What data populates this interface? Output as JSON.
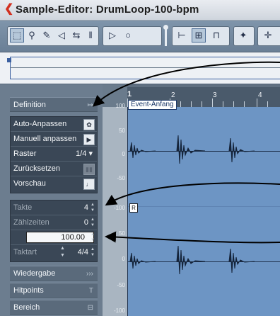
{
  "window": {
    "title": "Sample-Editor: DrumLoop-100-bpm",
    "colors": {
      "accent": "#d23020",
      "wave_bg": "#6d95c4",
      "panel_bg": "#6c7d8f"
    }
  },
  "toolbar": {
    "buttons": [
      {
        "name": "range-select-icon",
        "glyph": "⬚",
        "selected": true
      },
      {
        "name": "zoom-icon",
        "glyph": "⚲"
      },
      {
        "name": "draw-icon",
        "glyph": "✎"
      },
      {
        "name": "play-icon",
        "glyph": "🔈"
      },
      {
        "name": "scrub-icon",
        "glyph": "⇆"
      },
      {
        "name": "hitpoint-icon",
        "glyph": "‖"
      },
      {
        "name": "play-arrow-icon",
        "glyph": "▷"
      },
      {
        "name": "loop-icon",
        "glyph": "○"
      },
      {
        "name": "snap-to-zero-icon",
        "glyph": "⊢"
      },
      {
        "name": "autoscroll-icon",
        "glyph": "⊞"
      },
      {
        "name": "show-regions-icon",
        "glyph": "⊓"
      },
      {
        "name": "audio-event-icon",
        "glyph": "✦"
      },
      {
        "name": "marker-icon",
        "glyph": "✛"
      }
    ]
  },
  "panel": {
    "sections": [
      {
        "key": "definition",
        "label": "Definition",
        "icon": "↦"
      },
      {
        "key": "wiedergabe",
        "label": "Wiedergabe",
        "icon": "›››"
      },
      {
        "key": "hitpoints",
        "label": "Hitpoints",
        "icon": "T"
      },
      {
        "key": "bereich",
        "label": "Bereich",
        "icon": "⊟"
      }
    ],
    "actions": [
      {
        "label": "Auto-Anpassen",
        "icon": "gear-icon",
        "glyph": "✿"
      },
      {
        "label": "Manuell anpassen",
        "icon": "play-icon",
        "glyph": "▶"
      },
      {
        "label": "Raster",
        "value": "1/4"
      },
      {
        "label": "Zurücksetzen",
        "icon": "reset-icon",
        "glyph": "▮▮"
      },
      {
        "label": "Vorschau",
        "icon": "note-icon",
        "glyph": "♩"
      }
    ],
    "musical": {
      "takte_label": "Takte",
      "takte_value": "4",
      "zaehlzeiten_label": "Zählzeiten",
      "zaehlzeiten_value": "0",
      "tempo_value": "100.00",
      "taktart_label": "Taktart",
      "taktart_value": "4/4"
    }
  },
  "ruler": {
    "bars": [
      "1",
      "2",
      "3",
      "4"
    ]
  },
  "amplitude_scale": {
    "labels": [
      "100",
      "50",
      "0",
      "-50",
      "-100",
      "50",
      "0",
      "-50",
      "-100"
    ]
  },
  "event": {
    "start_label": "Event-Anfang",
    "region_marker": "R"
  }
}
